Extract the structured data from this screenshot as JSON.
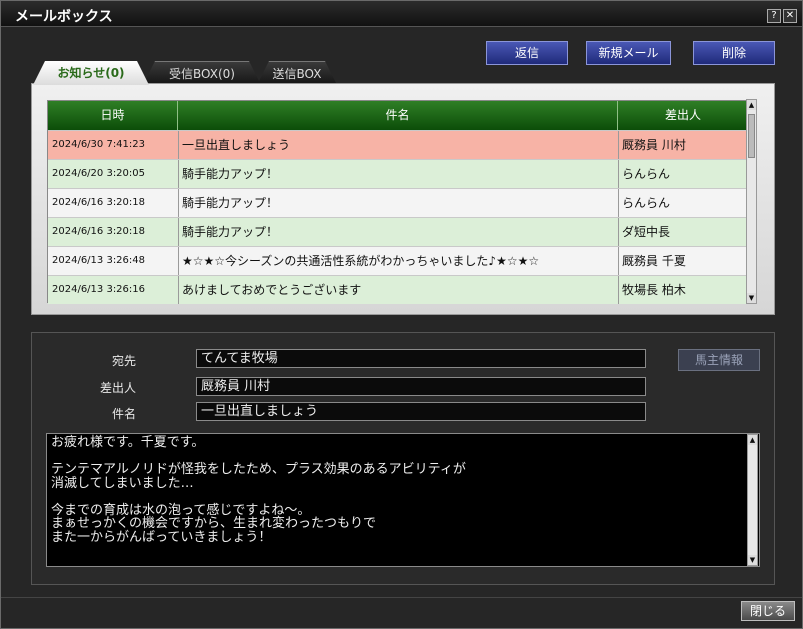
{
  "window": {
    "title": "メールボックス",
    "help_glyph": "?",
    "close_glyph": "✕"
  },
  "actions": {
    "reply": "返信",
    "new_mail": "新規メール",
    "delete": "削除"
  },
  "tabs": {
    "notice": "お知らせ(0)",
    "inbox": "受信BOX(0)",
    "sent": "送信BOX"
  },
  "list": {
    "headers": {
      "date": "日時",
      "subject": "件名",
      "sender": "差出人"
    },
    "rows": [
      {
        "date": "2024/6/30 7:41:23",
        "subject": "一旦出直しましょう",
        "sender": "厩務員 川村"
      },
      {
        "date": "2024/6/20 3:20:05",
        "subject": "騎手能力アップ！",
        "sender": "らんらん"
      },
      {
        "date": "2024/6/16 3:20:18",
        "subject": "騎手能力アップ！",
        "sender": "らんらん"
      },
      {
        "date": "2024/6/16 3:20:18",
        "subject": "騎手能力アップ！",
        "sender": "ダ短中長"
      },
      {
        "date": "2024/6/13 3:26:48",
        "subject": "★☆★☆今シーズンの共通活性系統がわかっちゃいました♪★☆★☆",
        "sender": "厩務員 千夏"
      },
      {
        "date": "2024/6/13 3:26:16",
        "subject": "あけましておめでとうございます",
        "sender": "牧場長 柏木"
      }
    ]
  },
  "detail": {
    "to_label": "宛先",
    "to_value": "てんてま牧場",
    "from_label": "差出人",
    "from_value": "厩務員 川村",
    "subject_label": "件名",
    "subject_value": "一旦出直しましょう",
    "owner_info_button": "馬主情報",
    "body": "お疲れ様です。千夏です。\n\nテンテマアルノリドが怪我をしたため、プラス効果のあるアビリティが\n消滅してしまいました…\n\n今までの育成は水の泡って感じですよね～。\nまぁせっかくの機会ですから、生まれ変わったつもりで\nまた一からがんばっていきましょう！"
  },
  "scroll": {
    "up_glyph": "▲",
    "down_glyph": "▼"
  },
  "footer": {
    "close_button": "閉じる"
  }
}
